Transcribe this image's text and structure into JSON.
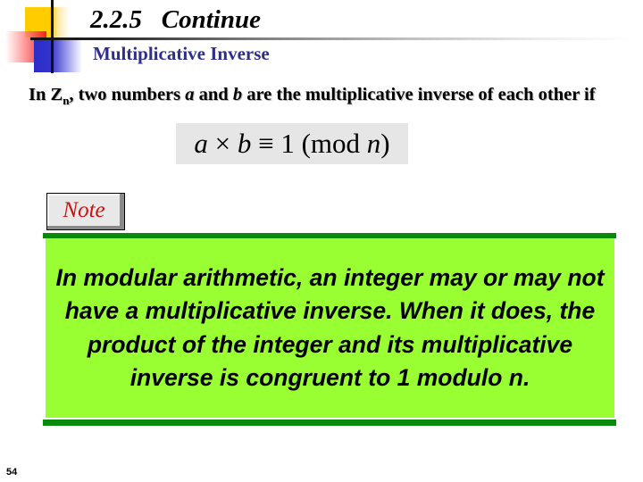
{
  "slide": {
    "title": "2.2.5   Continue",
    "subtitle": "Multiplicative Inverse",
    "body": {
      "prefix": "In Z",
      "subscript": "n",
      "part1": ", two numbers ",
      "var_a": "a",
      "part2": " and ",
      "var_b": "b",
      "part3": " are the multiplicative inverse of each other if"
    },
    "formula": {
      "a": "a",
      "times": " × ",
      "b": "b",
      "equiv": " ≡ 1 (mod ",
      "n": "n",
      "close": ")"
    },
    "note": {
      "label": "Note",
      "text": "In modular arithmetic, an integer may or may not have a multiplicative inverse. When it does, the product of the integer and its multiplicative inverse is congruent to 1 modulo n."
    },
    "page_number": "54"
  },
  "colors": {
    "subtitle": "#2e2e8c",
    "note_label": "#cc1111",
    "note_background": "#99ff33",
    "note_border": "#0a8a0a",
    "formula_background": "#e6e6e6"
  }
}
